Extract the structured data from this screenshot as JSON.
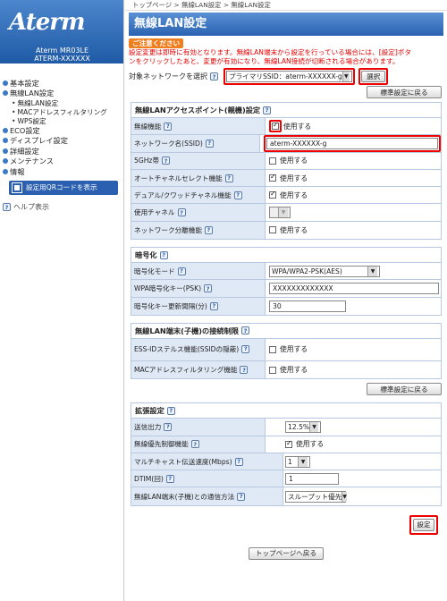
{
  "sidebar": {
    "logo": "Aterm",
    "model": "Aterm MR03LE",
    "name": "ATERM-XXXXXX",
    "items": [
      {
        "label": "基本設定",
        "sub": []
      },
      {
        "label": "無線LAN設定",
        "sub": [
          "無線LAN設定",
          "MACアドレスフィルタリング",
          "WPS設定"
        ]
      },
      {
        "label": "ECO設定",
        "sub": []
      },
      {
        "label": "ディスプレイ設定",
        "sub": []
      },
      {
        "label": "詳細設定",
        "sub": []
      },
      {
        "label": "メンテナンス",
        "sub": []
      },
      {
        "label": "情報",
        "sub": []
      }
    ],
    "qr_button": "設定用QRコードを表示",
    "help": "ヘルプ表示"
  },
  "breadcrumb": "トップページ > 無線LAN設定 > 無線LAN設定",
  "title": "無線LAN設定",
  "caution": {
    "label": "ご注意ください",
    "line1": "設定変更は即時に有効となります。無線LAN端末から設定を行っている場合には、[設定]ボタ",
    "line2": "ンをクリックしたあと、変更が有効になり、無線LAN接続が切断される場合があります。"
  },
  "network_select": {
    "label": "対象ネットワークを選択",
    "value": "プライマリSSID：aterm-XXXXXX-g",
    "button": "選択"
  },
  "reset_label": "標準設定に戻る",
  "sections": {
    "ap": {
      "title": "無線LANアクセスポイント(親機)設定",
      "rows": [
        {
          "label": "無線機能",
          "type": "check",
          "checked": true,
          "text": "使用する"
        },
        {
          "label": "ネットワーク名(SSID)",
          "type": "text",
          "value": "aterm-XXXXXX-g"
        },
        {
          "label": "5GHz帯",
          "type": "check",
          "checked": false,
          "text": "使用する"
        },
        {
          "label": "オートチャネルセレクト機能",
          "type": "check",
          "checked": true,
          "text": "使用する"
        },
        {
          "label": "デュアル/クワッドチャネル機能",
          "type": "check",
          "checked": true,
          "text": "使用する"
        },
        {
          "label": "使用チャネル",
          "type": "select",
          "value": ""
        },
        {
          "label": "ネットワーク分離機能",
          "type": "check",
          "checked": false,
          "text": "使用する"
        }
      ]
    },
    "enc": {
      "title": "暗号化",
      "rows": [
        {
          "label": "暗号化モード",
          "type": "select",
          "value": "WPA/WPA2-PSK(AES)"
        },
        {
          "label": "WPA暗号化キー(PSK)",
          "type": "text",
          "value": "XXXXXXXXXXXXX"
        },
        {
          "label": "暗号化キー更新間隔(分)",
          "type": "text",
          "value": "30"
        }
      ]
    },
    "restrict": {
      "title": "無線LAN端末(子機)の接続制限",
      "rows": [
        {
          "label": "ESS-IDステルス機能(SSIDの隠蔽)",
          "type": "check",
          "checked": false,
          "text": "使用する"
        },
        {
          "label": "MACアドレスフィルタリング機能",
          "type": "check",
          "checked": false,
          "text": "使用する"
        }
      ]
    },
    "ext": {
      "title": "拡張設定",
      "rows": [
        {
          "label": "送信出力",
          "type": "select",
          "value": "12.5%"
        },
        {
          "label": "無線優先制御機能",
          "type": "check",
          "checked": true,
          "text": "使用する"
        },
        {
          "label": "マルチキャスト伝送速度(Mbps)",
          "type": "select",
          "value": "1"
        },
        {
          "label": "DTIM(回)",
          "type": "text",
          "value": "1"
        },
        {
          "label": "無線LAN端末(子機)との通信方法",
          "type": "select",
          "value": "スループット優先"
        }
      ]
    }
  },
  "set_button": "設定",
  "top_button": "トップページへ戻る"
}
